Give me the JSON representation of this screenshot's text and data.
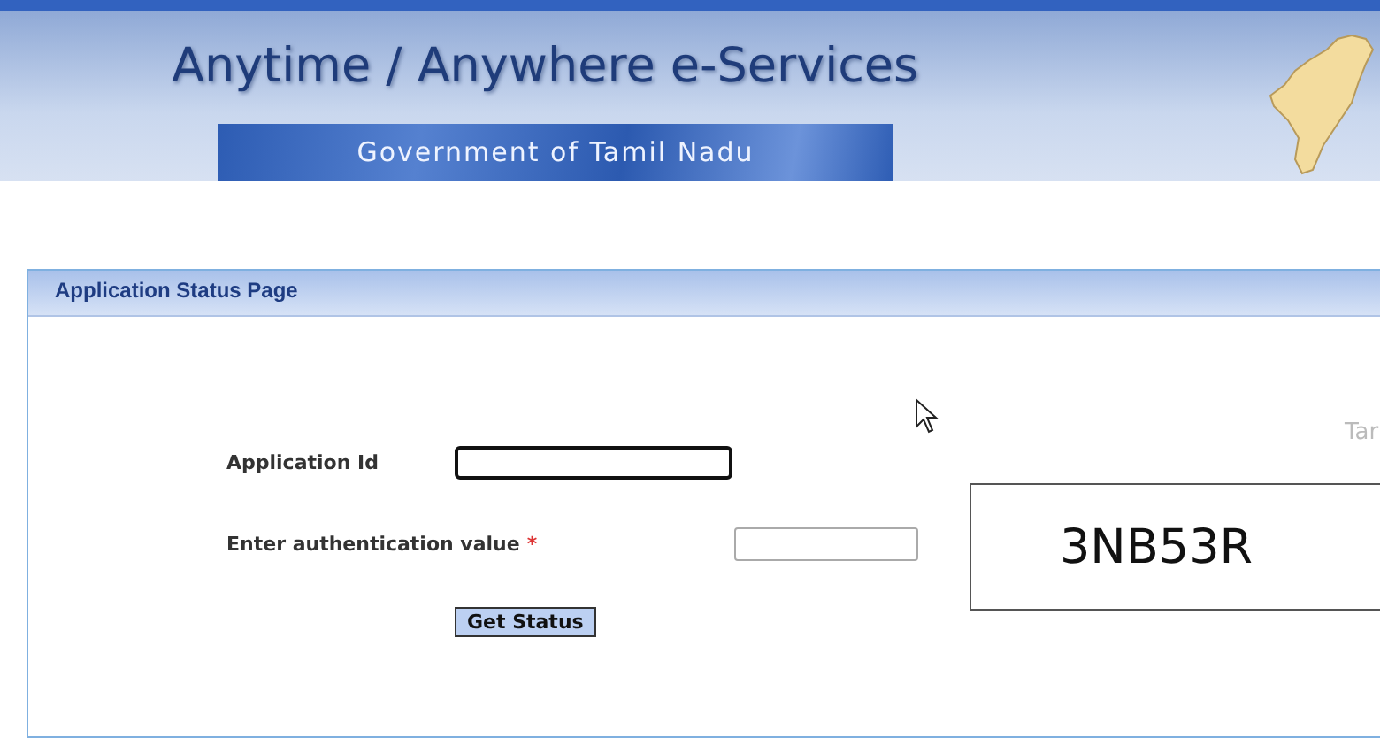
{
  "header": {
    "title": "Anytime / Anywhere e-Services",
    "subtitle": "Government of Tamil Nadu"
  },
  "panel": {
    "title": "Application Status Page",
    "side_text": "Tar",
    "fields": [
      {
        "label": "Application Id",
        "required": false,
        "focused": true
      },
      {
        "label": "Enter authentication value",
        "required": true,
        "required_mark": "*",
        "focused": false
      }
    ],
    "captcha": "3NB53R",
    "button": "Get Status"
  }
}
